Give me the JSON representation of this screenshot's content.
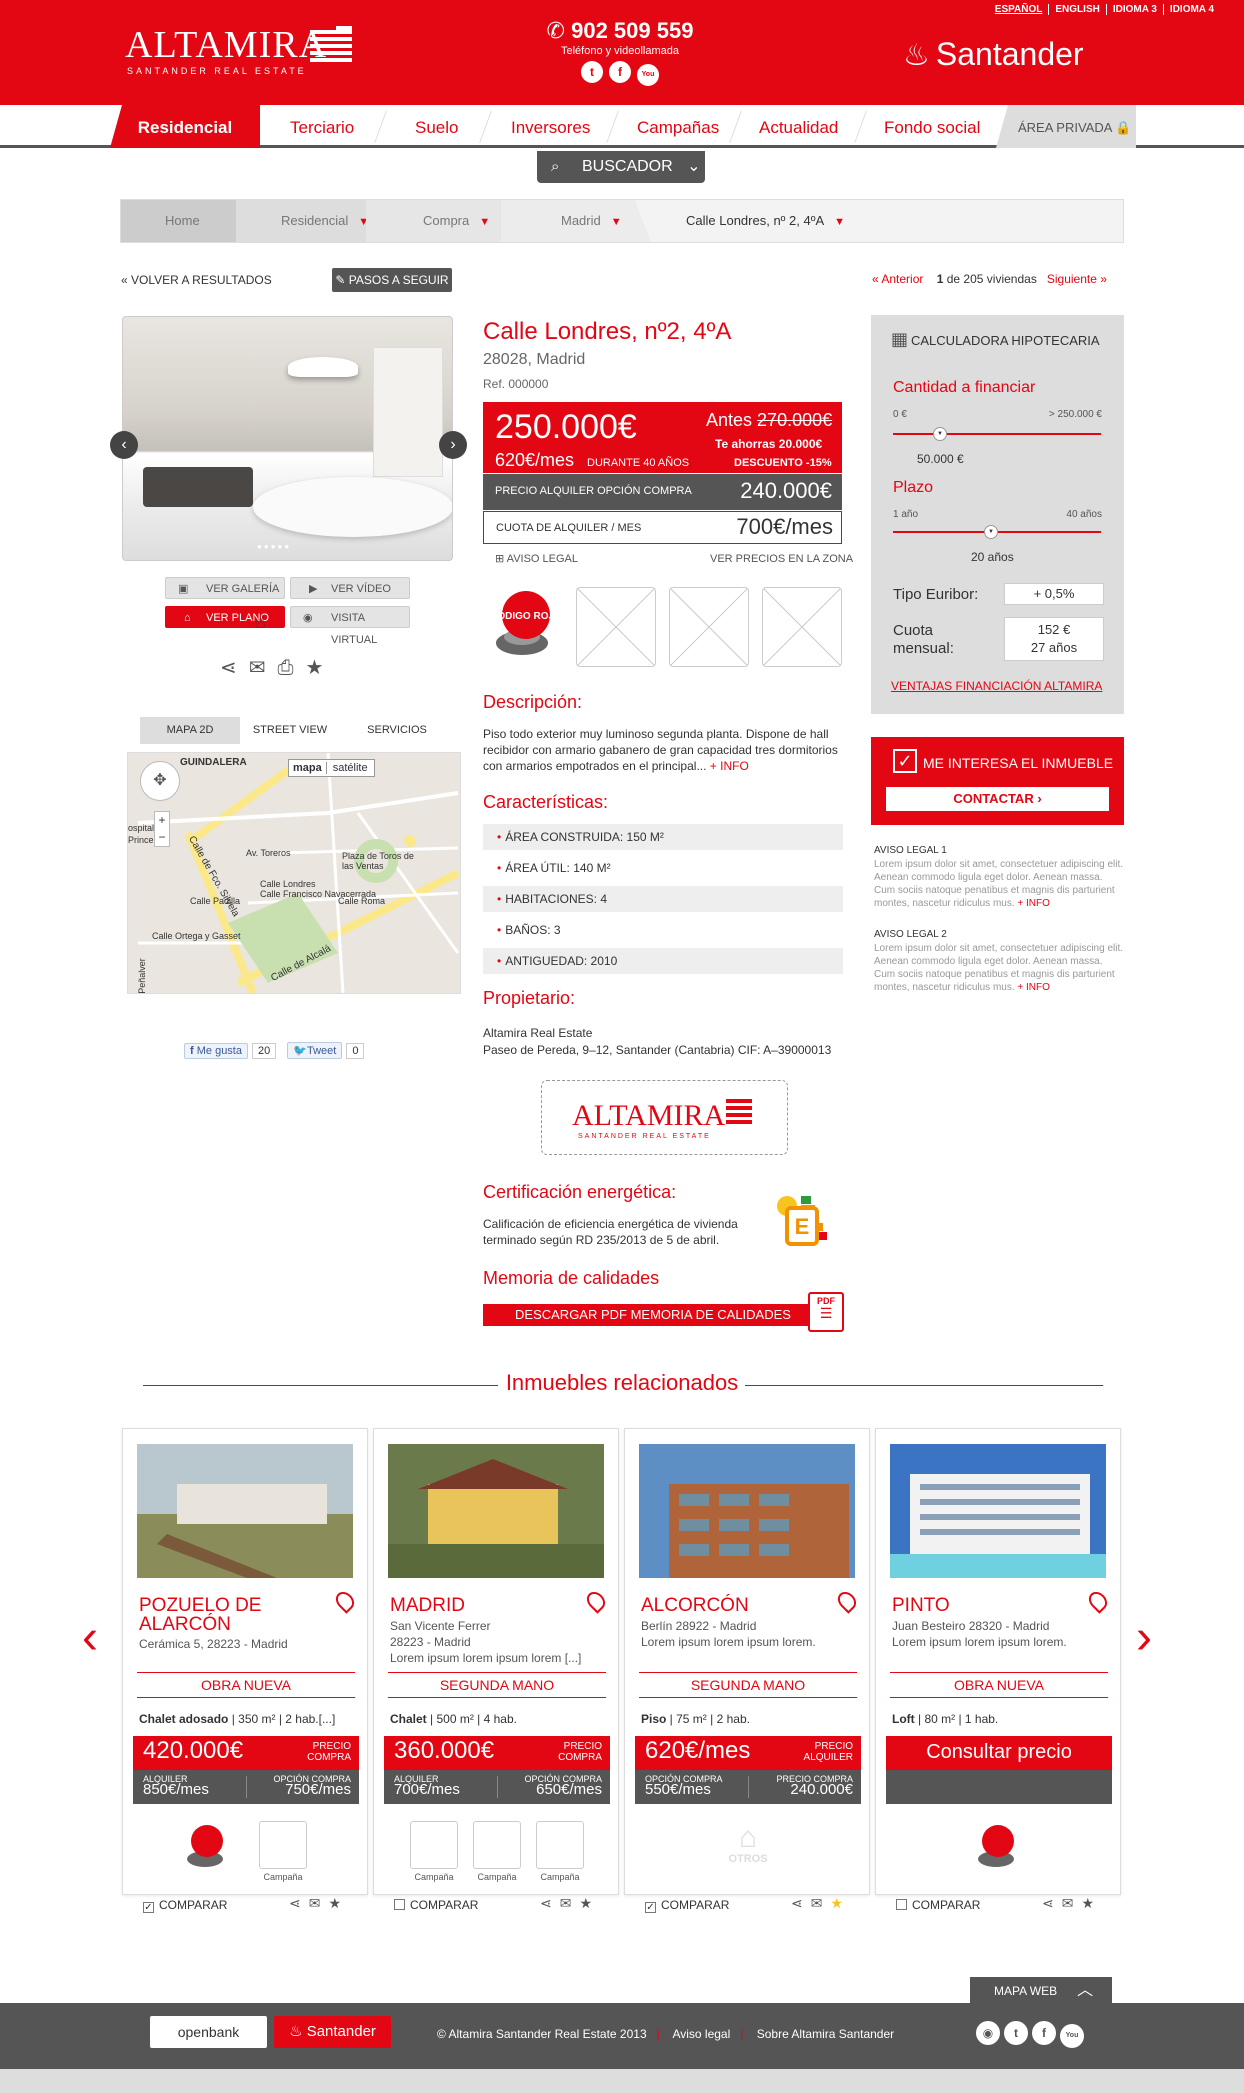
{
  "header": {
    "logo_word": "ALTAMIRA",
    "logo_sub": "SANTANDER REAL ESTATE",
    "phone": "902 509 559",
    "phone_sub": "Teléfono y videollamada",
    "social": [
      "twitter-icon",
      "facebook-icon",
      "youtube-icon"
    ],
    "languages": [
      "ESPAÑOL",
      "ENGLISH",
      "IDIOMA 3",
      "IDIOMA 4"
    ],
    "brand": "Santander"
  },
  "nav": {
    "items": [
      "Residencial",
      "Terciario",
      "Suelo",
      "Inversores",
      "Campañas",
      "Actualidad",
      "Fondo social"
    ],
    "area_privada": "ÁREA PRIVADA",
    "buscador": "BUSCADOR"
  },
  "breadcrumb": [
    "Home",
    "Residencial",
    "Compra",
    "Madrid",
    "Calle Londres, nº 2, 4ºA"
  ],
  "topbar": {
    "back": "« VOLVER A RESULTADOS",
    "pasos": "PASOS A SEGUIR",
    "prev": "« Anterior",
    "count_num": "1",
    "count_txt": "de 205 viviendas",
    "next": "Siguiente »"
  },
  "gallery": {
    "buttons": [
      "VER GALERÍA",
      "VER VÍDEO",
      "VER PLANO",
      "VISITA VIRTUAL"
    ],
    "dots": "●●●●●"
  },
  "map": {
    "tabs": [
      "MAPA 2D",
      "STREET VIEW",
      "SERVICIOS"
    ],
    "toggle": [
      "mapa",
      "satélite"
    ],
    "streets": [
      "GUINDALERA",
      "Calle de Alcalá",
      "Calle Londres",
      "Calle Francisco Navacerrada",
      "Calle Padilla",
      "Calle Roma",
      "Av. Toreros",
      "Plaza de Toros de las Ventas",
      "Calle Ortega y Gasset",
      "Calle de Fco. Silvela",
      "Peñalver",
      "Prince",
      "ospital"
    ]
  },
  "social_counts": {
    "like": "Me gusta",
    "like_count": "20",
    "tweet": "Tweet",
    "tweet_count": "0"
  },
  "property": {
    "title": "Calle Londres, nº2, 4ºA",
    "address": "28028, Madrid",
    "ref": "Ref. 000000",
    "price": "250.000€",
    "monthly": "620€/mes",
    "durante": "DURANTE 40 AÑOS",
    "antes_label": "Antes",
    "antes_value": "270.000€",
    "ahorras": "Te ahorras 20.000€",
    "descuento": "DESCUENTO -15%",
    "alquiler_label": "PRECIO ALQUILER OPCIÓN COMPRA",
    "alquiler_value": "240.000€",
    "cuota_label": "CUOTA DE ALQUILER / MES",
    "cuota_value": "700€/mes",
    "aviso": "AVISO LEGAL",
    "ver_precios": "VER PRECIOS EN LA ZONA",
    "codigo": "CÓDIGO ROJO",
    "desc_title": "Descripción:",
    "desc": "Piso todo exterior muy luminoso segunda planta. Dispone de hall recibidor con armario gabanero de gran capacidad tres dormitorios con armarios empotrados en el principal...",
    "desc_more": "+ INFO",
    "char_title": "Características:",
    "characteristics": [
      "ÁREA CONSTRUIDA: 150 M²",
      "ÁREA ÚTIL: 140 M²",
      "HABITACIONES: 4",
      "BAÑOS: 3",
      "ANTIGUEDAD: 2010"
    ],
    "owner_title": "Propietario:",
    "owner_name": "Altamira Real Estate",
    "owner_addr": "Paseo de Pereda, 9–12, Santander (Cantabria) CIF: A–39000013",
    "cert_title": "Certificación energética:",
    "cert_text": "Calificación de eficiencia energética de vivienda terminado según RD 235/2013 de 5 de abril.",
    "cert_letter": "E",
    "mem_title": "Memoria de calidades",
    "pdf_btn": "DESCARGAR PDF MEMORIA DE CALIDADES",
    "pdf_label": "PDF"
  },
  "calculator": {
    "title": "CALCULADORA HIPOTECARIA",
    "cantidad": "Cantidad a financiar",
    "cant_min": "0 €",
    "cant_max": "> 250.000 €",
    "cant_value": "50.000 €",
    "plazo": "Plazo",
    "plazo_min": "1 año",
    "plazo_max": "40 años",
    "plazo_value": "20 años",
    "euribor_label": "Tipo Euribor:",
    "euribor_value": "+ 0,5%",
    "cuota_label_1": "Cuota",
    "cuota_label_2": "mensual:",
    "cuota_value_1": "152 €",
    "cuota_value_2": "27 años",
    "ventajas": "VENTAJAS FINANCIACIÓN ALTAMIRA"
  },
  "interest": {
    "title": "ME INTERESA EL INMUEBLE",
    "button": "CONTACTAR"
  },
  "legal": [
    {
      "title": "AVISO LEGAL 1",
      "text": "Lorem ipsum dolor sit amet, consectetuer adipiscing elit. Aenean commodo ligula eget dolor. Aenean massa. Cum sociis natoque penatibus et magnis dis parturient montes, nascetur ridiculus mus.",
      "more": "+ INFO"
    },
    {
      "title": "AVISO LEGAL 2",
      "text": "Lorem ipsum dolor sit amet, consectetuer adipiscing elit. Aenean commodo ligula eget dolor. Aenean massa. Cum sociis natoque penatibus et magnis dis parturient montes, nascetur ridiculus mus.",
      "more": "+ INFO"
    }
  ],
  "related": {
    "title": "Inmuebles relacionados",
    "cards": [
      {
        "city": "POZUELO DE ALARCÓN",
        "addr": [
          "Cerámica 5, 28223 - Madrid"
        ],
        "tag": "OBRA NUEVA",
        "type": "Chalet adosado",
        "det": " | 350 m² | 2 hab.[...]",
        "price": "420.000€",
        "price_label": "PRECIO COMPRA",
        "sub1_l": "ALQUILER",
        "sub1_v": "850€/mes",
        "sub2_l": "OPCIÓN COMPRA",
        "sub2_v": "750€/mes",
        "compare": "COMPARAR",
        "checked": "✓"
      },
      {
        "city": "MADRID",
        "addr": [
          "San Vicente Ferrer",
          "28223 - Madrid",
          "Lorem ipsum lorem ipsum lorem [...]"
        ],
        "tag": "SEGUNDA MANO",
        "type": "Chalet",
        "det": " | 500 m² | 4 hab.",
        "price": "360.000€",
        "price_label": "PRECIO COMPRA",
        "sub1_l": "ALQUILER",
        "sub1_v": "700€/mes",
        "sub2_l": "OPCIÓN COMPRA",
        "sub2_v": "650€/mes",
        "camp": "Campaña",
        "compare": "COMPARAR",
        "checked": ""
      },
      {
        "city": "ALCORCÓN",
        "addr": [
          "Berlín 28922 - Madrid",
          "Lorem ipsum lorem ipsum lorem."
        ],
        "tag": "SEGUNDA MANO",
        "type": "Piso",
        "det": " | 75 m² | 2 hab.",
        "price": "620€/mes",
        "price_label": "PRECIO ALQUILER",
        "sub1_l": "OPCIÓN COMPRA",
        "sub1_v": "550€/mes",
        "sub2_l": "PRECIO COMPRA",
        "sub2_v": "240.000€",
        "otros": "OTROS",
        "compare": "COMPARAR",
        "checked": "✓"
      },
      {
        "city": "PINTO",
        "addr": [
          "Juan Besteiro 28320 - Madrid",
          "Lorem ipsum lorem ipsum lorem."
        ],
        "tag": "OBRA NUEVA",
        "type": "Loft",
        "det": " | 80 m² | 1 hab.",
        "consultar": "Consultar precio",
        "compare": "COMPARAR",
        "checked": ""
      }
    ]
  },
  "footer": {
    "mapa_web": "MAPA WEB",
    "openbank": "openbank",
    "santander": "Santander",
    "copyright": "© Altamira Santander Real Estate 2013",
    "aviso": "Aviso legal",
    "sobre": "Sobre Altamira Santander"
  }
}
